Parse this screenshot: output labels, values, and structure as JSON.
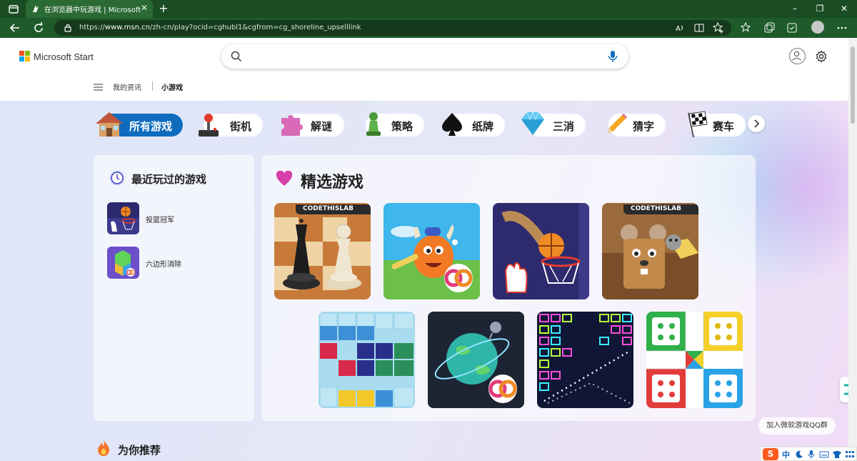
{
  "browser": {
    "tab_title": "在浏览器中玩游戏 | Microsoft Start",
    "tab_close": "✕",
    "new_tab": "+",
    "url_prefix": "https://",
    "url_host": "www.msn.cn",
    "url_path": "/zh-cn/play?ocid=cghubl1&cgfrom=cg_shoreline_upselllink",
    "controls": [
      "–",
      "❐",
      "✕"
    ]
  },
  "header": {
    "brand": "Microsoft Start",
    "search_placeholder": "",
    "nav": [
      "我的资讯",
      "小游戏"
    ]
  },
  "categories": [
    {
      "label": "所有游戏",
      "icon": "house-icon",
      "active": true
    },
    {
      "label": "街机",
      "icon": "joystick-icon",
      "active": false
    },
    {
      "label": "解谜",
      "icon": "puzzle-icon",
      "active": false
    },
    {
      "label": "策略",
      "icon": "pawn-icon",
      "active": false
    },
    {
      "label": "纸牌",
      "icon": "spade-icon",
      "active": false
    },
    {
      "label": "三消",
      "icon": "diamond-icon",
      "active": false
    },
    {
      "label": "猜字",
      "icon": "pencil-icon",
      "active": false
    },
    {
      "label": "赛车",
      "icon": "checkered-flag-icon",
      "active": false
    }
  ],
  "recent": {
    "title": "最近玩过的游戏",
    "items": [
      {
        "name": "投篮冠军"
      },
      {
        "name": "六边形消除"
      }
    ]
  },
  "featured": {
    "title": "精选游戏",
    "badge_text": "CODETHISLAB"
  },
  "recommend_title": "为你推荐",
  "qq_button": "加入微软游戏QQ群",
  "ime": {
    "brand": "S",
    "lang": "中"
  },
  "colors": {
    "tabbar": "#1b4d24",
    "toolbar": "#1e5a2a",
    "accent": "#0f6cbd"
  }
}
